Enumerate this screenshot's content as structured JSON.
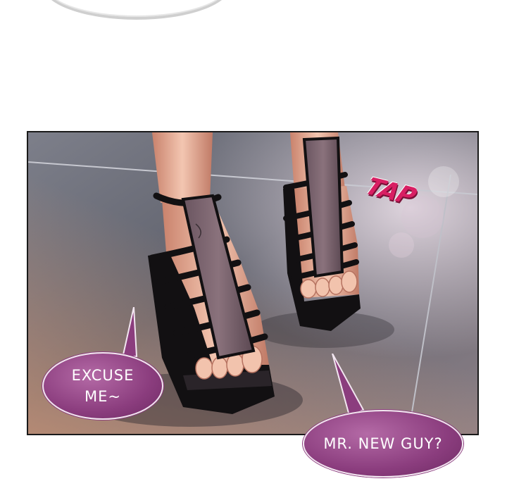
{
  "panel": {
    "sound_effect": "TAP"
  },
  "dialogue": [
    {
      "line1": "EXCUSE",
      "line2": "ME~"
    },
    {
      "line1": "MR. NEW GUY?"
    }
  ],
  "colors": {
    "bubble_fill": "#8b3d7e",
    "sfx": "#d81f63",
    "strap": "#121012",
    "skin": "#e8b09a",
    "floor": "#6e6f78"
  },
  "icons": [
    "speech-bubble-icon"
  ]
}
